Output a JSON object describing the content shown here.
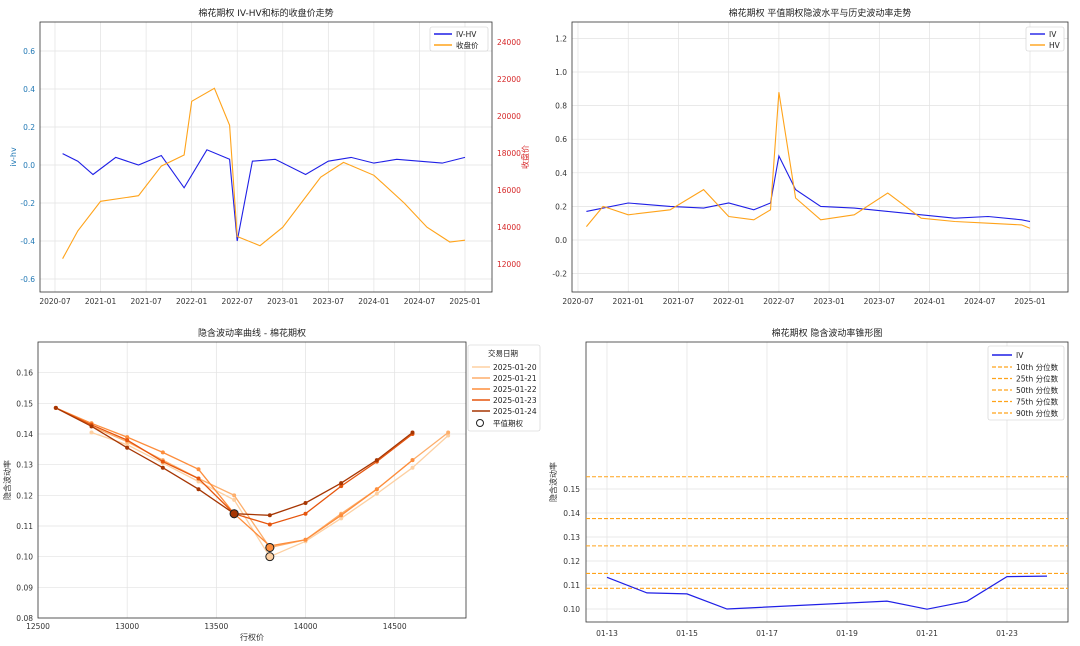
{
  "colors": {
    "blue": "#1f1fe6",
    "orange": "#ffa31a",
    "red_axis": "#d62728",
    "grid": "#e2e2e2",
    "light_blue_tick": "#1f77b4"
  },
  "chart_data": [
    {
      "type": "line",
      "title": "棉花期权 IV-HV和标的收盘价走势",
      "ylabel": "iv-hv",
      "y2label": "收盘价",
      "legend": [
        "IV-HV",
        "收盘价"
      ],
      "x_ticks": [
        "2020-07",
        "2021-01",
        "2021-07",
        "2022-01",
        "2022-07",
        "2023-01",
        "2023-07",
        "2024-01",
        "2024-07",
        "2025-01"
      ],
      "y_ticks": [
        "-0.6",
        "-0.4",
        "-0.2",
        "0.0",
        "0.2",
        "0.4",
        "0.6"
      ],
      "y2_ticks": [
        "12000",
        "14000",
        "16000",
        "18000",
        "20000",
        "22000",
        "24000"
      ],
      "ylim": [
        -0.75,
        0.75
      ],
      "y2lim": [
        11000,
        25000
      ],
      "series": [
        {
          "name": "IV-HV",
          "axis": "left",
          "x": [
            "2020-08",
            "2020-10",
            "2020-12",
            "2021-03",
            "2021-06",
            "2021-09",
            "2021-12",
            "2022-03",
            "2022-06",
            "2022-07",
            "2022-09",
            "2022-12",
            "2023-04",
            "2023-07",
            "2023-10",
            "2024-01",
            "2024-04",
            "2024-07",
            "2024-10",
            "2025-01"
          ],
          "values": [
            0.06,
            0.02,
            -0.05,
            0.04,
            0.0,
            0.05,
            -0.12,
            0.08,
            0.03,
            -0.4,
            0.02,
            0.03,
            -0.05,
            0.02,
            0.04,
            0.01,
            0.03,
            0.02,
            0.01,
            0.04
          ]
        },
        {
          "name": "收盘价",
          "axis": "right",
          "x": [
            "2020-08",
            "2020-10",
            "2021-01",
            "2021-06",
            "2021-09",
            "2021-12",
            "2022-01",
            "2022-04",
            "2022-06",
            "2022-07",
            "2022-10",
            "2023-01",
            "2023-06",
            "2023-09",
            "2024-01",
            "2024-05",
            "2024-08",
            "2024-11",
            "2025-01"
          ],
          "values": [
            12300,
            13800,
            15400,
            15700,
            17300,
            17900,
            20800,
            21500,
            19500,
            13500,
            13000,
            14000,
            16700,
            17500,
            16800,
            15300,
            14000,
            13200,
            13300
          ]
        }
      ]
    },
    {
      "type": "line",
      "title": "棉花期权 平值期权隐波水平与历史波动率走势",
      "legend": [
        "IV",
        "HV"
      ],
      "x_ticks": [
        "2020-07",
        "2021-01",
        "2021-07",
        "2022-01",
        "2022-07",
        "2023-01",
        "2023-07",
        "2024-01",
        "2024-07",
        "2025-01"
      ],
      "y_ticks": [
        "-0.2",
        "0.0",
        "0.2",
        "0.4",
        "0.6",
        "0.8",
        "1.0",
        "1.2"
      ],
      "ylim": [
        -0.35,
        1.3
      ],
      "series": [
        {
          "name": "IV",
          "x": [
            "2020-08",
            "2020-10",
            "2021-01",
            "2021-06",
            "2021-10",
            "2022-01",
            "2022-04",
            "2022-06",
            "2022-07",
            "2022-09",
            "2022-12",
            "2023-04",
            "2023-08",
            "2023-12",
            "2024-04",
            "2024-08",
            "2024-12",
            "2025-01"
          ],
          "values": [
            0.17,
            0.19,
            0.22,
            0.2,
            0.19,
            0.22,
            0.18,
            0.22,
            0.5,
            0.3,
            0.2,
            0.19,
            0.17,
            0.15,
            0.13,
            0.14,
            0.12,
            0.11
          ]
        },
        {
          "name": "HV",
          "x": [
            "2020-08",
            "2020-10",
            "2021-01",
            "2021-06",
            "2021-10",
            "2022-01",
            "2022-04",
            "2022-06",
            "2022-07",
            "2022-09",
            "2022-12",
            "2023-04",
            "2023-08",
            "2023-12",
            "2024-04",
            "2024-08",
            "2024-12",
            "2025-01"
          ],
          "values": [
            0.08,
            0.2,
            0.15,
            0.18,
            0.3,
            0.14,
            0.12,
            0.18,
            0.88,
            0.25,
            0.12,
            0.15,
            0.28,
            0.13,
            0.11,
            0.1,
            0.09,
            0.07
          ]
        }
      ]
    },
    {
      "type": "line",
      "title": "隐含波动率曲线 - 棉花期权",
      "xlabel": "行权价",
      "ylabel": "隐含波动率",
      "legend_title": "交易日期",
      "atm_label": "平值期权",
      "x_ticks": [
        "12500",
        "13000",
        "13500",
        "14000",
        "14500"
      ],
      "y_ticks": [
        "0.08",
        "0.09",
        "0.10",
        "0.11",
        "0.12",
        "0.13",
        "0.14",
        "0.15",
        "0.16"
      ],
      "xlim": [
        12500,
        14900
      ],
      "ylim": [
        0.08,
        0.17
      ],
      "series": [
        {
          "name": "2025-01-20",
          "color": "#fdd0a2",
          "x": [
            12800,
            13000,
            13200,
            13400,
            13600,
            13800,
            14000,
            14200,
            14400,
            14600,
            14800
          ],
          "values": [
            0.1405,
            0.1365,
            0.1305,
            0.1245,
            0.1185,
            0.1,
            0.105,
            0.1125,
            0.1205,
            0.129,
            0.1395
          ],
          "atm": [
            13800,
            0.1
          ]
        },
        {
          "name": "2025-01-21",
          "color": "#fdae6b",
          "x": [
            12800,
            13000,
            13200,
            13400,
            13600,
            13800,
            14000,
            14200,
            14400,
            14600,
            14800
          ],
          "values": [
            0.1425,
            0.1375,
            0.1315,
            0.1255,
            0.12,
            0.103,
            0.1055,
            0.114,
            0.122,
            0.1315,
            0.1405
          ],
          "atm": [
            13800,
            0.103
          ]
        },
        {
          "name": "2025-01-22",
          "color": "#fd8d3c",
          "x": [
            12600,
            12800,
            13000,
            13200,
            13400,
            13600,
            13800,
            14000,
            14200,
            14400,
            14600
          ],
          "values": [
            0.1485,
            0.1435,
            0.139,
            0.134,
            0.1285,
            0.114,
            0.1035,
            0.1055,
            0.1135,
            0.122,
            0.1315
          ],
          "atm": [
            13800,
            0.103
          ]
        },
        {
          "name": "2025-01-23",
          "color": "#e6550d",
          "x": [
            12600,
            12800,
            13000,
            13200,
            13400,
            13600,
            13800,
            14000,
            14200,
            14400,
            14600
          ],
          "values": [
            0.1485,
            0.143,
            0.138,
            0.131,
            0.1255,
            0.114,
            0.1105,
            0.114,
            0.123,
            0.131,
            0.14
          ],
          "atm": [
            13600,
            0.114
          ]
        },
        {
          "name": "2025-01-24",
          "color": "#a63603",
          "x": [
            12600,
            12800,
            13000,
            13200,
            13400,
            13600,
            13800,
            14000,
            14200,
            14400,
            14600
          ],
          "values": [
            0.1485,
            0.1425,
            0.1355,
            0.129,
            0.122,
            0.114,
            0.1135,
            0.1175,
            0.124,
            0.1315,
            0.1405
          ],
          "atm": [
            13600,
            0.114
          ]
        }
      ]
    },
    {
      "type": "line",
      "title": "棉花期权 隐含波动率锥形图",
      "ylabel": "隐含波动率",
      "x_ticks": [
        "01-13",
        "01-15",
        "01-17",
        "01-19",
        "01-21",
        "01-23"
      ],
      "y_ticks": [
        "0.10",
        "0.11",
        "0.12",
        "0.13",
        "0.14",
        "0.15"
      ],
      "ylim": [
        0.097,
        0.158
      ],
      "x": [
        "2025-01-13",
        "2025-01-14",
        "2025-01-15",
        "2025-01-16",
        "2025-01-20",
        "2025-01-21",
        "2025-01-22",
        "2025-01-23",
        "2025-01-24"
      ],
      "series": [
        {
          "name": "IV",
          "values": [
            0.1132,
            0.1067,
            0.1063,
            0.1,
            0.1033,
            0.0999,
            0.1032,
            0.1135,
            0.1137
          ]
        }
      ],
      "percentiles": [
        {
          "name": "10th 分位数",
          "value": 0.1086
        },
        {
          "name": "25th 分位数",
          "value": 0.1148
        },
        {
          "name": "50th 分位数",
          "value": 0.1263
        },
        {
          "name": "75th 分位数",
          "value": 0.1377
        },
        {
          "name": "90th 分位数",
          "value": 0.1551
        }
      ]
    }
  ]
}
